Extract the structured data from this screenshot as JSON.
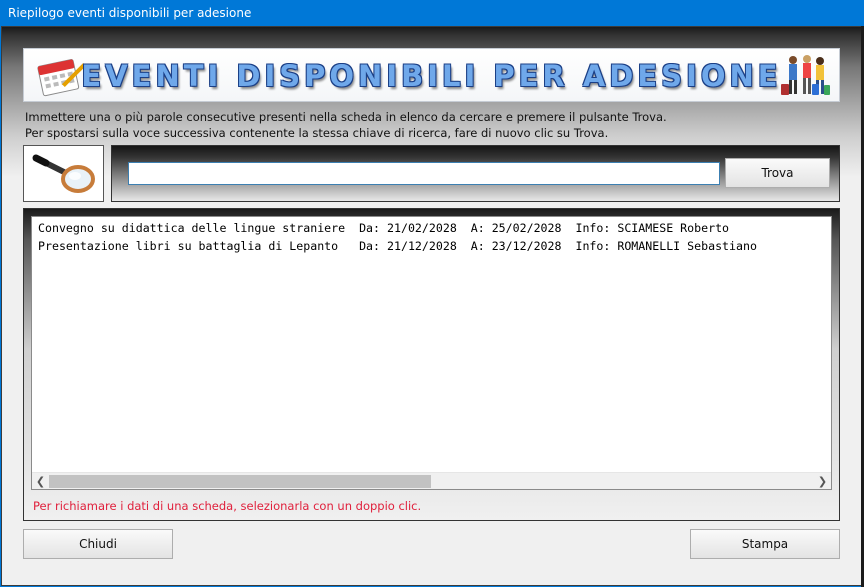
{
  "window": {
    "title": "Riepilogo eventi disponibili per adesione"
  },
  "banner": {
    "title": "EVENTI DISPONIBILI PER ADESIONE",
    "calendar_icon": "calendar-icon",
    "travelers_icon": "travelers-icon"
  },
  "instructions": {
    "line1": "Immettere una o più parole consecutive presenti nella scheda in elenco da cercare e premere il pulsante Trova.",
    "line2": "Per spostarsi sulla voce successiva contenente la stessa chiave di ricerca, fare di nuovo clic su Trova."
  },
  "search": {
    "value": "",
    "find_label": "Trova",
    "icon": "magnifier-icon"
  },
  "list": {
    "rows": [
      "Convegno su didattica delle lingue straniere  Da: 21/02/2028  A: 25/02/2028  Info: SCIAMESE Roberto",
      "Presentazione libri su battaglia di Lepanto   Da: 21/12/2028  A: 23/12/2028  Info: ROMANELLI Sebastiano"
    ],
    "hint": "Per richiamare i dati di una scheda, selezionarla con un doppio clic."
  },
  "footer": {
    "close_label": "Chiudi",
    "print_label": "Stampa"
  },
  "colors": {
    "titlebar": "#0078d7",
    "hint": "#e0203c",
    "banner_text": "#6fa8ea"
  }
}
